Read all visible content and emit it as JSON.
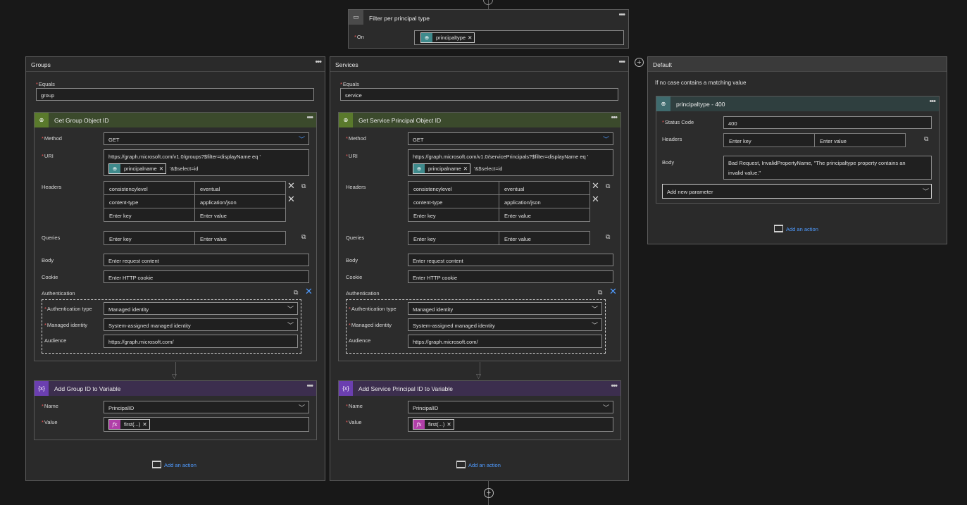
{
  "filter": {
    "title": "Filter per principal type",
    "on_label": "On",
    "token": "principaltype"
  },
  "groups": {
    "title": "Groups",
    "equals_label": "Equals",
    "equals_value": "group",
    "http": {
      "title": "Get Group Object ID",
      "method_label": "Method",
      "method_value": "GET",
      "uri_label": "URI",
      "uri_line1": "https://graph.microsoft.com/v1.0/groups?$filter=displayName eq '",
      "uri_token": "principalname",
      "uri_suffix": "'&$select=id",
      "headers_label": "Headers",
      "headers": [
        {
          "key": "consistencylevel",
          "value": "eventual"
        },
        {
          "key": "content-type",
          "value": "application/json"
        },
        {
          "key": "Enter key",
          "value": "Enter value"
        }
      ],
      "queries_label": "Queries",
      "queries": {
        "key": "Enter key",
        "value": "Enter value"
      },
      "body_label": "Body",
      "body_placeholder": "Enter request content",
      "cookie_label": "Cookie",
      "cookie_placeholder": "Enter HTTP cookie",
      "auth_label": "Authentication",
      "auth_type_label": "Authentication type",
      "auth_type_value": "Managed identity",
      "managed_identity_label": "Managed identity",
      "managed_identity_value": "System-assigned managed identity",
      "audience_label": "Audience",
      "audience_value": "https://graph.microsoft.com/"
    },
    "var": {
      "title": "Add Group ID to Variable",
      "name_label": "Name",
      "name_value": "PrincipalID",
      "value_label": "Value",
      "value_token": "first(...)"
    },
    "add_action": "Add an action"
  },
  "services": {
    "title": "Services",
    "equals_label": "Equals",
    "equals_value": "service",
    "http": {
      "title": "Get Service Principal Object ID",
      "method_label": "Method",
      "method_value": "GET",
      "uri_label": "URI",
      "uri_line1": "https://graph.microsoft.com/v1.0/servicePrincipals?$filter=displayName eq '",
      "uri_token": "principalname",
      "uri_suffix": "'&$select=id",
      "headers_label": "Headers",
      "headers": [
        {
          "key": "consistencylevel",
          "value": "eventual"
        },
        {
          "key": "content-type",
          "value": "application/json"
        },
        {
          "key": "Enter key",
          "value": "Enter value"
        }
      ],
      "queries_label": "Queries",
      "queries": {
        "key": "Enter key",
        "value": "Enter value"
      },
      "body_label": "Body",
      "body_placeholder": "Enter request content",
      "cookie_label": "Cookie",
      "cookie_placeholder": "Enter HTTP cookie",
      "auth_label": "Authentication",
      "auth_type_label": "Authentication type",
      "auth_type_value": "Managed identity",
      "managed_identity_label": "Managed identity",
      "managed_identity_value": "System-assigned managed identity",
      "audience_label": "Audience",
      "audience_value": "https://graph.microsoft.com/"
    },
    "var": {
      "title": "Add Service Principal ID to Variable",
      "name_label": "Name",
      "name_value": "PrincipalID",
      "value_label": "Value",
      "value_token": "first(...)"
    },
    "add_action": "Add an action"
  },
  "default": {
    "title": "Default",
    "note": "If no case contains a matching value",
    "response": {
      "title": "principaltype - 400",
      "status_label": "Status Code",
      "status_value": "400",
      "headers_label": "Headers",
      "headers_key": "Enter key",
      "headers_value": "Enter value",
      "body_label": "Body",
      "body_line1": "Bad Request, InvalidPropertyName, \"The principaltype property contains an",
      "body_line2": "invalid value.\"",
      "add_param": "Add new parameter"
    },
    "add_action": "Add an action"
  },
  "icons": [
    "switch-icon",
    "ellipsis-icon",
    "globe-icon",
    "chevron-down-icon",
    "close-icon",
    "table-switch-icon",
    "variable-icon",
    "fx-icon",
    "add-action-icon",
    "plus-circle-icon",
    "arrow-down-icon"
  ],
  "colors": {
    "accent": "#4f9bff",
    "http_header": "#3b4a2c",
    "var_header": "#3c2e4e",
    "required": "#f25c5c"
  }
}
